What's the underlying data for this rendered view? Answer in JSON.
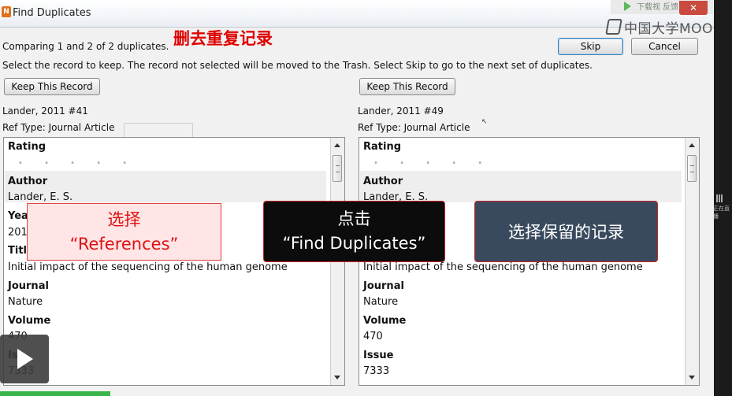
{
  "window": {
    "app_icon_text": "N",
    "title": "Find Duplicates",
    "close_glyph": "✕"
  },
  "watermark": {
    "download_text": "下载视   反馈",
    "brand": "中国大学MOOC",
    "side_text": "正在直播"
  },
  "header": {
    "annotation_title": "删去重复记录",
    "comparing_text": "Comparing 1 and 2 of 2 duplicates.",
    "instruction_text": "Select the record to keep. The record not selected will be moved to the Trash. Select Skip to go to the next set of duplicates.",
    "skip_label": "Skip",
    "cancel_label": "Cancel"
  },
  "left": {
    "keep_label": "Keep This Record",
    "record_id": "Lander, 2011 #41",
    "ref_type": "Ref Type: Journal Article",
    "fields": {
      "rating_label": "Rating",
      "rating_dots": "• • • • •",
      "author_label": "Author",
      "author_value": "Lander, E. S.",
      "year_label": "Yea",
      "year_value": "201",
      "title_label": "Titl",
      "title_value": "Initial impact of the sequencing of the human genome",
      "journal_label": "Journal",
      "journal_value": "Nature",
      "volume_label": "Volume",
      "volume_value": "470",
      "issue_label": "Is",
      "issue_value": "7333"
    }
  },
  "right": {
    "keep_label": "Keep This Record",
    "record_id": "Lander, 2011 #49",
    "ref_type": "Ref Type: Journal Article",
    "fields": {
      "rating_label": "Rating",
      "rating_dots": "• • • • •",
      "author_label": "Author",
      "author_value": "Lander, E. S.",
      "title_value": "Initial impact of the sequencing of the human genome",
      "journal_label": "Journal",
      "journal_value": "Nature",
      "volume_label": "Volume",
      "volume_value": "470",
      "issue_label": "Issue",
      "issue_value": "7333"
    }
  },
  "overlays": {
    "pink_line1": "选择",
    "pink_line2": "“References”",
    "black_line1": "点击",
    "black_line2": "“Find Duplicates”",
    "blue_text": "选择保留的记录"
  },
  "colors": {
    "annotation_red": "#e00000",
    "overlay_blue": "#3a4a5e",
    "progress_green": "#3bb54a"
  }
}
